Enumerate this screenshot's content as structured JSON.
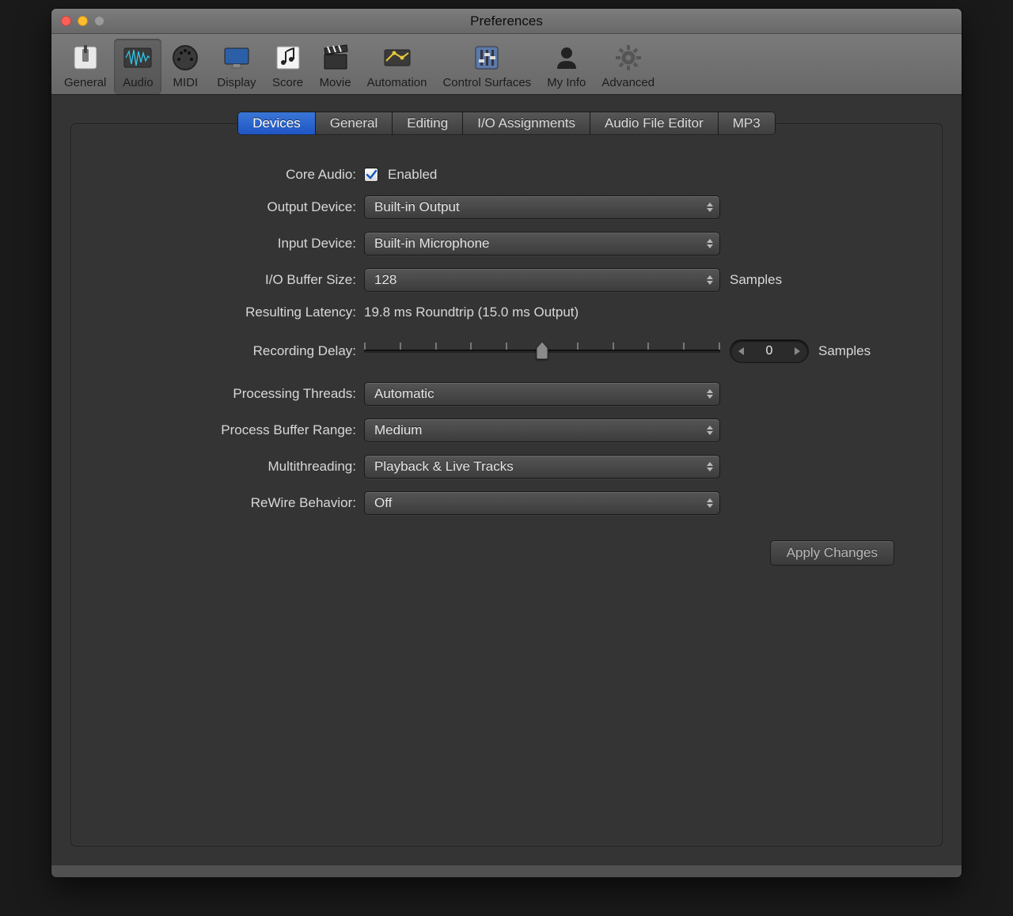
{
  "window": {
    "title": "Preferences"
  },
  "toolbar": {
    "items": [
      {
        "label": "General"
      },
      {
        "label": "Audio"
      },
      {
        "label": "MIDI"
      },
      {
        "label": "Display"
      },
      {
        "label": "Score"
      },
      {
        "label": "Movie"
      },
      {
        "label": "Automation"
      },
      {
        "label": "Control Surfaces"
      },
      {
        "label": "My Info"
      },
      {
        "label": "Advanced"
      }
    ],
    "selected": "Audio"
  },
  "tabs": {
    "items": [
      "Devices",
      "General",
      "Editing",
      "I/O Assignments",
      "Audio File Editor",
      "MP3"
    ],
    "active": "Devices"
  },
  "form": {
    "core_audio": {
      "label": "Core Audio:",
      "checkbox_label": "Enabled",
      "checked": true
    },
    "output_device": {
      "label": "Output Device:",
      "value": "Built-in Output"
    },
    "input_device": {
      "label": "Input Device:",
      "value": "Built-in Microphone"
    },
    "io_buffer": {
      "label": "I/O Buffer Size:",
      "value": "128",
      "suffix": "Samples"
    },
    "resulting_latency": {
      "label": "Resulting Latency:",
      "value": "19.8 ms Roundtrip (15.0 ms Output)"
    },
    "recording_delay": {
      "label": "Recording Delay:",
      "value": "0",
      "suffix": "Samples"
    },
    "processing_threads": {
      "label": "Processing Threads:",
      "value": "Automatic"
    },
    "process_buffer_range": {
      "label": "Process Buffer Range:",
      "value": "Medium"
    },
    "multithreading": {
      "label": "Multithreading:",
      "value": "Playback & Live Tracks"
    },
    "rewire": {
      "label": "ReWire Behavior:",
      "value": "Off"
    }
  },
  "buttons": {
    "apply": "Apply Changes"
  }
}
